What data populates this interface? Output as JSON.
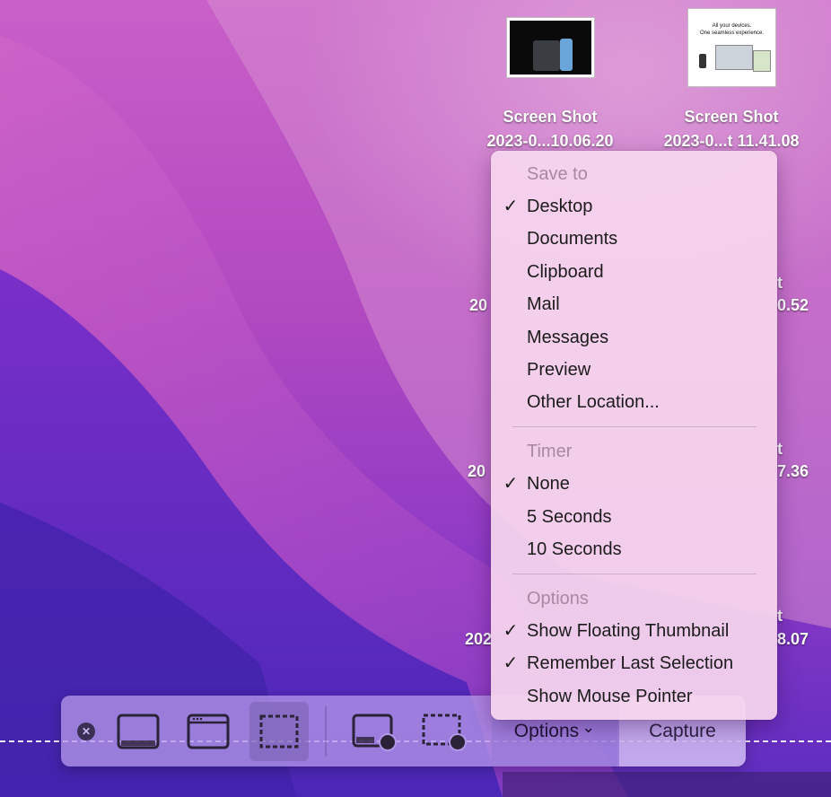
{
  "desktop": {
    "files": [
      {
        "name_line1": "Screen Shot",
        "name_line2": "2023-0...10.06.20"
      },
      {
        "name_line1": "Screen Shot",
        "name_line2": "2023-0...t 11.41.08",
        "thumb_text1": "All your devices.",
        "thumb_text2": "One seamless experience."
      }
    ],
    "partial_labels": [
      "20",
      "t",
      "0.52",
      "20",
      "t",
      "7.36",
      "202",
      "t",
      "8.07"
    ]
  },
  "menu": {
    "save_to": {
      "header": "Save to",
      "items": [
        {
          "label": "Desktop",
          "checked": "✓"
        },
        {
          "label": "Documents",
          "checked": ""
        },
        {
          "label": "Clipboard",
          "checked": ""
        },
        {
          "label": "Mail",
          "checked": ""
        },
        {
          "label": "Messages",
          "checked": ""
        },
        {
          "label": "Preview",
          "checked": ""
        },
        {
          "label": "Other Location...",
          "checked": ""
        }
      ]
    },
    "timer": {
      "header": "Timer",
      "items": [
        {
          "label": "None",
          "checked": "✓"
        },
        {
          "label": "5 Seconds",
          "checked": ""
        },
        {
          "label": "10 Seconds",
          "checked": ""
        }
      ]
    },
    "options": {
      "header": "Options",
      "items": [
        {
          "label": "Show Floating Thumbnail",
          "checked": "✓"
        },
        {
          "label": "Remember Last Selection",
          "checked": "✓"
        },
        {
          "label": "Show Mouse Pointer",
          "checked": ""
        }
      ]
    }
  },
  "toolbar": {
    "close_glyph": "✕",
    "options_label": "Options",
    "options_chevron": "⌄",
    "capture_label": "Capture"
  },
  "colors": {
    "menu_bg": "#f6d6ee",
    "toolbar_bg": "#b296e8",
    "icon_dark": "#2a2236"
  }
}
